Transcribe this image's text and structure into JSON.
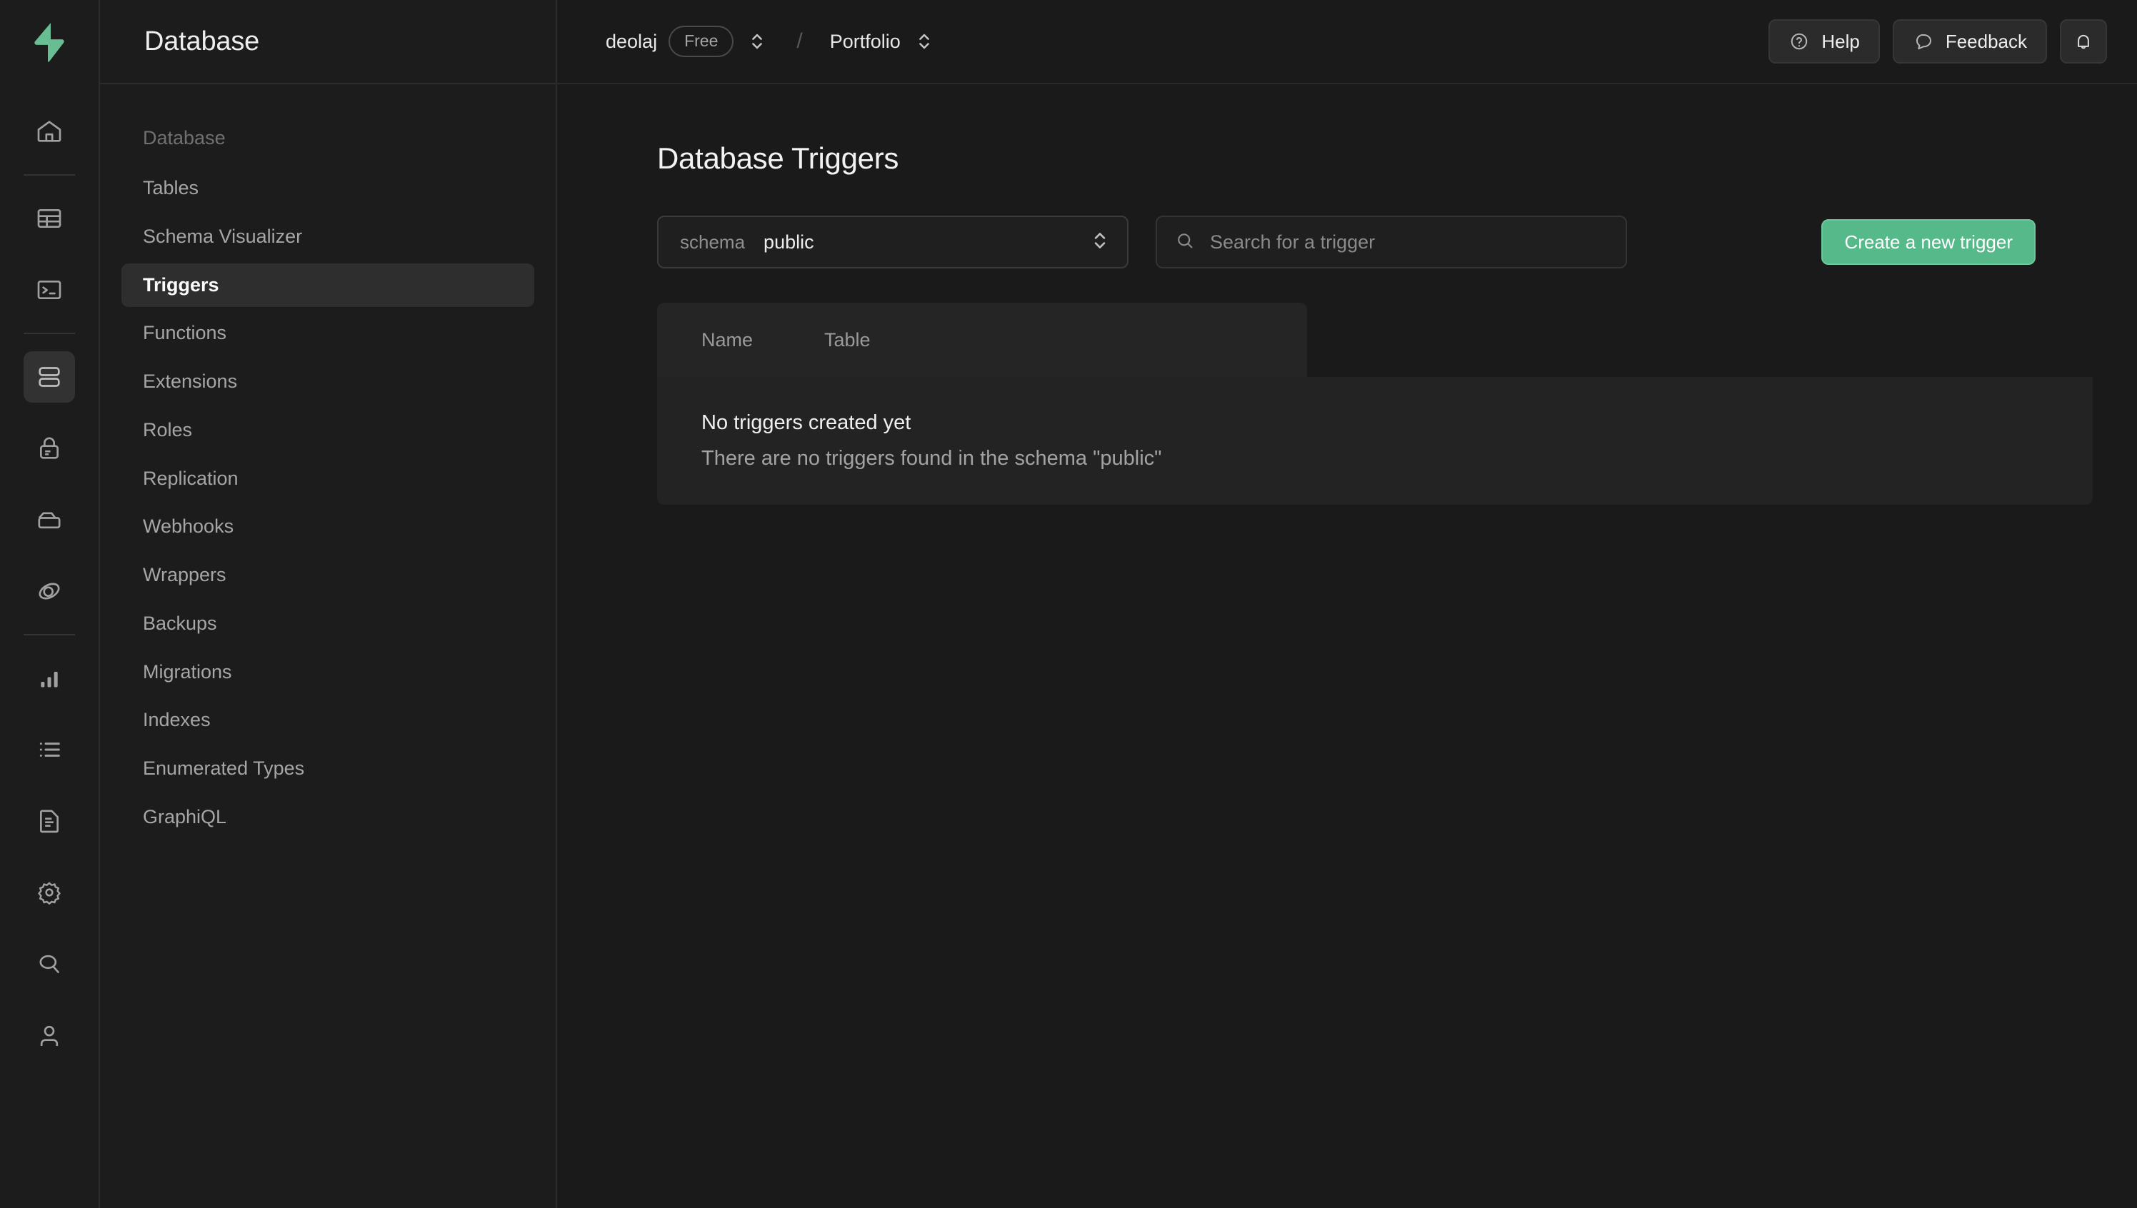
{
  "brand": {
    "logo_icon": "supabase-lightning-logo",
    "accent_color": "#3ecf8e",
    "button_green": "#56b98a"
  },
  "rail": {
    "items": [
      {
        "icon": "home-icon",
        "name": "home"
      },
      {
        "divider": true
      },
      {
        "icon": "table-editor-icon",
        "name": "table-editor"
      },
      {
        "icon": "sql-editor-icon",
        "name": "sql-editor"
      },
      {
        "divider": true
      },
      {
        "icon": "database-icon",
        "name": "database",
        "active": true
      },
      {
        "icon": "lock-icon",
        "name": "authentication"
      },
      {
        "icon": "storage-icon",
        "name": "storage"
      },
      {
        "icon": "edge-functions-icon",
        "name": "edge-functions"
      },
      {
        "divider": true
      },
      {
        "icon": "bar-chart-icon",
        "name": "reports"
      },
      {
        "icon": "list-icon",
        "name": "logs"
      },
      {
        "icon": "document-icon",
        "name": "api-docs"
      },
      {
        "icon": "gear-icon",
        "name": "project-settings"
      },
      {
        "icon": "search-icon",
        "name": "search"
      },
      {
        "icon": "user-icon",
        "name": "account"
      }
    ]
  },
  "sidebar": {
    "title": "Database",
    "section_label": "Database",
    "items": [
      {
        "label": "Tables",
        "active": false
      },
      {
        "label": "Schema Visualizer",
        "active": false
      },
      {
        "label": "Triggers",
        "active": true
      },
      {
        "label": "Functions",
        "active": false
      },
      {
        "label": "Extensions",
        "active": false
      },
      {
        "label": "Roles",
        "active": false
      },
      {
        "label": "Replication",
        "active": false
      },
      {
        "label": "Webhooks",
        "active": false
      },
      {
        "label": "Wrappers",
        "active": false
      },
      {
        "label": "Backups",
        "active": false
      },
      {
        "label": "Migrations",
        "active": false
      },
      {
        "label": "Indexes",
        "active": false
      },
      {
        "label": "Enumerated Types",
        "active": false
      },
      {
        "label": "GraphiQL",
        "active": false
      }
    ]
  },
  "topbar": {
    "org": "deolaj",
    "plan": "Free",
    "separator": "/",
    "project": "Portfolio",
    "help_label": "Help",
    "feedback_label": "Feedback",
    "notifications_icon": "bell-icon"
  },
  "main": {
    "page_title": "Database Triggers",
    "schema": {
      "label": "schema",
      "value": "public"
    },
    "search": {
      "placeholder": "Search for a trigger",
      "value": ""
    },
    "create_button": "Create a new trigger",
    "table": {
      "columns": [
        "Name",
        "Table"
      ],
      "rows": [],
      "empty_title": "No triggers created yet",
      "empty_subtitle": "There are no triggers found in the schema \"public\""
    }
  }
}
